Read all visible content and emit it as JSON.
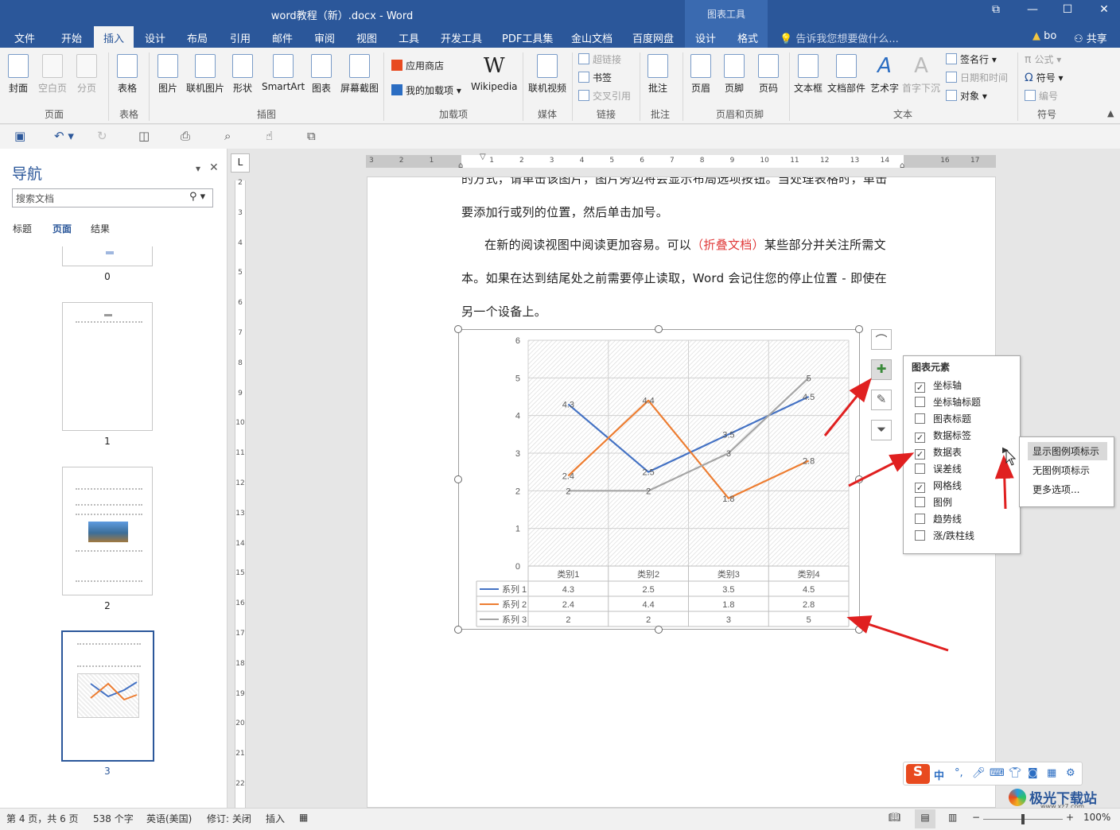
{
  "titlebar": {
    "document_title": "word教程（新）.docx - Word",
    "context_tools": "图表工具",
    "restore_icon": "⧉",
    "minimize": "—",
    "maximize": "☐",
    "close": "✕"
  },
  "tabs": {
    "file": "文件",
    "home": "开始",
    "insert": "插入",
    "design": "设计",
    "layout": "布局",
    "references": "引用",
    "mailings": "邮件",
    "review": "审阅",
    "view": "视图",
    "tools": "工具",
    "developer": "开发工具",
    "pdf": "PDF工具集",
    "kingsoft": "金山文档",
    "baidu": "百度网盘",
    "chart_design": "设计",
    "chart_format": "格式",
    "tellme": "告诉我您想要做什么...",
    "user": "bo",
    "share": "共享"
  },
  "ribbon": {
    "cover": "封面",
    "blank": "空白页",
    "pagebreak": "分页",
    "group_pages": "页面",
    "table": "表格",
    "group_table": "表格",
    "picture": "图片",
    "online_picture": "联机图片",
    "shapes": "形状",
    "smartart": "SmartArt",
    "chart": "图表",
    "screenshot": "屏幕截图",
    "group_illustrations": "插图",
    "store": "应用商店",
    "my_addins": "我的加载项",
    "wikipedia": "Wikipedia",
    "group_addins": "加载项",
    "online_video": "联机视频",
    "group_media": "媒体",
    "hyperlink": "超链接",
    "bookmark": "书签",
    "crossref": "交叉引用",
    "group_links": "链接",
    "comment": "批注",
    "group_comments": "批注",
    "header": "页眉",
    "footer": "页脚",
    "pagenum": "页码",
    "group_hf": "页眉和页脚",
    "textbox": "文本框",
    "quickparts": "文档部件",
    "wordart": "艺术字",
    "dropcap": "首字下沉",
    "signature": "签名行",
    "datetime": "日期和时间",
    "object": "对象",
    "group_text": "文本",
    "equation": "公式",
    "symbol": "符号",
    "number": "编号",
    "group_symbols": "符号"
  },
  "nav": {
    "title": "导航",
    "search_placeholder": "搜索文档",
    "tab_headings": "标题",
    "tab_pages": "页面",
    "tab_results": "结果",
    "thumbs": [
      "0",
      "1",
      "2",
      "3"
    ]
  },
  "doc": {
    "line1": "的方式，请单击该图片，图片旁边将会显示布局选项按钮。当处理表格时，单击",
    "line2": "要添加行或列的位置，然后单击加号。",
    "line3a": "在新的阅读视图中阅读更加容易。可以",
    "line3b": "（折叠文档）",
    "line3c": "某些部分并关注所需文",
    "line4": "本。如果在达到结尾处之前需要停止读取，Word 会记住您的停止位置 - 即使在",
    "line5": "另一个设备上。"
  },
  "chart_data": {
    "type": "line",
    "categories": [
      "类别1",
      "类别2",
      "类别3",
      "类别4"
    ],
    "series": [
      {
        "name": "系列 1",
        "values": [
          4.3,
          2.5,
          3.5,
          4.5
        ],
        "color": "#4472c4"
      },
      {
        "name": "系列 2",
        "values": [
          2.4,
          4.4,
          1.8,
          2.8
        ],
        "color": "#ed7d31"
      },
      {
        "name": "系列 3",
        "values": [
          2,
          2,
          3,
          5
        ],
        "color": "#a5a5a5"
      }
    ],
    "ylim": [
      0,
      6
    ],
    "yticks": [
      "0",
      "1",
      "2",
      "3",
      "4",
      "5",
      "6"
    ],
    "grid": true,
    "data_labels": true,
    "data_table": true,
    "title": "",
    "xlabel": "",
    "ylabel": ""
  },
  "chart_panel": {
    "header": "图表元素",
    "items": [
      {
        "label": "坐标轴",
        "checked": true
      },
      {
        "label": "坐标轴标题",
        "checked": false
      },
      {
        "label": "图表标题",
        "checked": false
      },
      {
        "label": "数据标签",
        "checked": true
      },
      {
        "label": "数据表",
        "checked": true
      },
      {
        "label": "误差线",
        "checked": false
      },
      {
        "label": "网格线",
        "checked": true
      },
      {
        "label": "图例",
        "checked": false
      },
      {
        "label": "趋势线",
        "checked": false
      },
      {
        "label": "涨/跌柱线",
        "checked": false
      }
    ],
    "submenu": [
      "显示图例项标示",
      "无图例项标示",
      "更多选项..."
    ]
  },
  "status": {
    "page": "第 4 页，共 6 页",
    "words": "538 个字",
    "lang": "英语(美国)",
    "track": "修订: 关闭",
    "insert": "插入",
    "zoom": "100%"
  },
  "ime": {
    "lang": "中"
  },
  "watermark": {
    "text": "极光下载站",
    "url": "www.xz7.com"
  }
}
